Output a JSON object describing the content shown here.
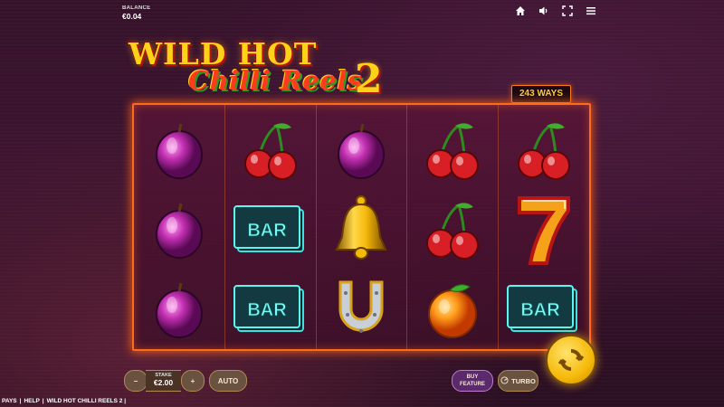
{
  "balance": {
    "label": "BALANCE",
    "value": "€0.04"
  },
  "top_icons": [
    "home-icon",
    "volume-icon",
    "fullscreen-icon",
    "menu-icon"
  ],
  "logo": {
    "line1": "WILD HOT",
    "line2": "Chilli Reels",
    "line3": "2"
  },
  "ways": "243 WAYS",
  "reels": [
    [
      "plum",
      "plum",
      "plum"
    ],
    [
      "cherries",
      "bar",
      "bar"
    ],
    [
      "plum",
      "bell",
      "horseshoe"
    ],
    [
      "cherries",
      "cherries",
      "orange"
    ],
    [
      "cherries",
      "seven",
      "bar"
    ]
  ],
  "controls": {
    "minus": "−",
    "stake_label": "STAKE",
    "stake_value": "€2.00",
    "plus": "+",
    "auto": "AUTO",
    "buy_line1": "BUY",
    "buy_line2": "FEATURE",
    "turbo": "TURBO"
  },
  "footer": {
    "pays": "PAYS",
    "sep1": "|",
    "help": "HELP",
    "sep2": "|",
    "title": "WILD HOT CHILLI REELS 2 |"
  },
  "colors": {
    "frame": "#ff6a1a",
    "gold": "#ffd21a",
    "spin": "#f5b90a"
  }
}
